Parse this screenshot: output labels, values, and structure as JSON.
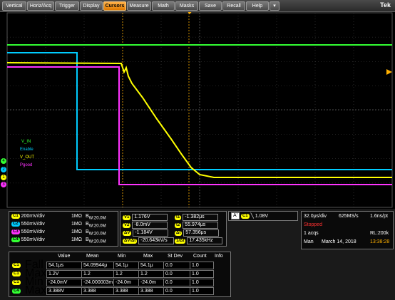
{
  "menu": {
    "items": [
      "Vertical",
      "Horiz/Acq",
      "Trigger",
      "Display",
      "Cursors",
      "Measure",
      "Math",
      "Masks",
      "Save",
      "Recall",
      "Help",
      "▾"
    ],
    "active": "Cursors",
    "brand": "Tek"
  },
  "colors": {
    "ch1": "#ffff00",
    "ch2": "#00ccff",
    "ch3": "#ff33ff",
    "ch4": "#33ff33",
    "cursor": "#ffb000",
    "accent": "#e07a00"
  },
  "traces": {
    "labels": [
      {
        "text": "V_IN",
        "color": "#33ff33"
      },
      {
        "text": "Enable",
        "color": "#00ccff"
      },
      {
        "text": "V_OUT",
        "color": "#ffff00"
      },
      {
        "text": "Pgood",
        "color": "#ff33ff"
      }
    ],
    "channel_markers": [
      "4",
      "2",
      "1",
      "3"
    ]
  },
  "channels": [
    {
      "id": "C1",
      "color": "#ffff00",
      "scale": "200mV/div",
      "imp": "1MΩ",
      "bw": "B",
      "bwval": "W:20.0M"
    },
    {
      "id": "C2",
      "color": "#00ccff",
      "scale": "550mV/div",
      "imp": "1MΩ",
      "bw": "B",
      "bwval": "W:20.0M"
    },
    {
      "id": "C3",
      "color": "#ff33ff",
      "scale": "550mV/div",
      "imp": "1MΩ",
      "bw": "B",
      "bwval": "W:20.0M"
    },
    {
      "id": "C4",
      "color": "#33ff33",
      "scale": "550mV/div",
      "imp": "1MΩ",
      "bw": "B",
      "bwval": "W:20.0M"
    }
  ],
  "cursors": {
    "v1": {
      "label": "V1",
      "value": "1.176V"
    },
    "v2": {
      "label": "V2",
      "value": "-8.0mV"
    },
    "dv": {
      "label": "ΔV",
      "value": "-1.184V"
    },
    "dvdt": {
      "label": "ΔV/Δt",
      "value": "-20.643kV/s"
    },
    "t1": {
      "label": "t1",
      "value": "-1.382μs"
    },
    "t2": {
      "label": "t2",
      "value": "55.974μs"
    },
    "dt": {
      "label": "Δt",
      "value": "57.356μs"
    },
    "inv": {
      "label": "1/Δt",
      "value": "17.435kHz"
    }
  },
  "trigger": {
    "source": "A'",
    "ch": "C1",
    "slope": "╲",
    "level": "1.08V"
  },
  "acquisition": {
    "timebase": "32.0μs/div",
    "sample_rate": "625MS/s",
    "resolution": "1.6ns/pt",
    "status": "Stopped",
    "acqs": "1 acqs",
    "record_length": "RL:200k",
    "mode": "Man",
    "date": "March 14, 2018",
    "time": "13:38:28"
  },
  "measurements": {
    "headers": [
      "Value",
      "Mean",
      "Min",
      "Max",
      "St Dev",
      "Count",
      "Info"
    ],
    "rows": [
      {
        "ch": "C1",
        "color": "#ffff00",
        "name": "Fall",
        "value": "54.1μs",
        "mean": "54.09944μ",
        "min": "54.1μ",
        "max": "54.1μ",
        "stdev": "0.0",
        "count": "1.0"
      },
      {
        "ch": "C1",
        "color": "#ffff00",
        "name": "Max",
        "value": "1.2V",
        "mean": "1.2",
        "min": "1.2",
        "max": "1.2",
        "stdev": "0.0",
        "count": "1.0"
      },
      {
        "ch": "C1",
        "color": "#ffff00",
        "name": "Min",
        "value": "-24.0mV",
        "mean": "-24.000003m",
        "min": "-24.0m",
        "max": "-24.0m",
        "stdev": "0.0",
        "count": "1.0"
      },
      {
        "ch": "C4",
        "color": "#33ff33",
        "name": "Max",
        "value": "3.388V",
        "mean": "3.388",
        "min": "3.388",
        "max": "3.388",
        "stdev": "0.0",
        "count": "1.0"
      }
    ]
  }
}
